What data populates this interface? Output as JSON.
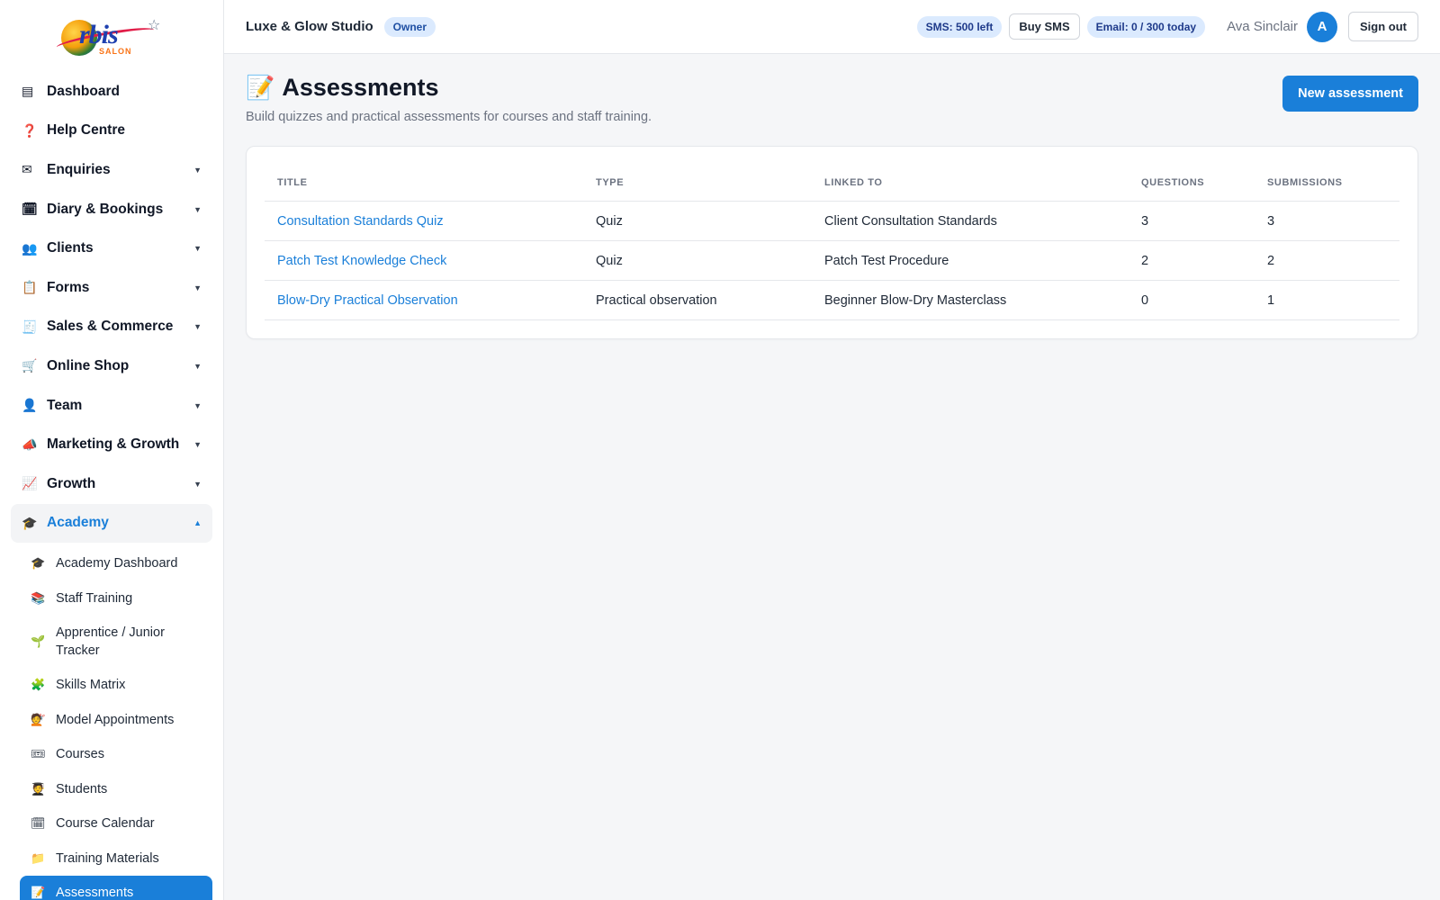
{
  "brand": {
    "logo_text": "rbis",
    "logo_sub": "SALON"
  },
  "sidebar": {
    "items": [
      {
        "label": "Dashboard",
        "icon": "▤",
        "has_caret": false
      },
      {
        "label": "Help Centre",
        "icon": "❓",
        "has_caret": false
      },
      {
        "label": "Enquiries",
        "icon": "✉",
        "has_caret": true
      },
      {
        "label": "Diary & Bookings",
        "icon": "🗓",
        "has_caret": true
      },
      {
        "label": "Clients",
        "icon": "👥",
        "has_caret": true
      },
      {
        "label": "Forms",
        "icon": "📋",
        "has_caret": true
      },
      {
        "label": "Sales & Commerce",
        "icon": "🧾",
        "has_caret": true
      },
      {
        "label": "Online Shop",
        "icon": "🛒",
        "has_caret": true
      },
      {
        "label": "Team",
        "icon": "👤",
        "has_caret": true
      },
      {
        "label": "Marketing & Growth",
        "icon": "📣",
        "has_caret": true
      },
      {
        "label": "Growth",
        "icon": "📈",
        "has_caret": true
      }
    ],
    "open_section": {
      "label": "Academy",
      "icon": "🎓"
    },
    "caret_down": "▼",
    "caret_up": "▲",
    "sub_items": [
      {
        "label": "Academy Dashboard",
        "icon": "🎓"
      },
      {
        "label": "Staff Training",
        "icon": "📚"
      },
      {
        "label": "Apprentice / Junior Tracker",
        "icon": "🌱"
      },
      {
        "label": "Skills Matrix",
        "icon": "🧩"
      },
      {
        "label": "Model Appointments",
        "icon": "💇"
      },
      {
        "label": "Courses",
        "icon": "🎟"
      },
      {
        "label": "Students",
        "icon": "🧑‍🎓"
      },
      {
        "label": "Course Calendar",
        "icon": "🗓"
      },
      {
        "label": "Training Materials",
        "icon": "📁"
      },
      {
        "label": "Assessments",
        "icon": "📝",
        "active": true
      }
    ]
  },
  "topbar": {
    "studio_name": "Luxe & Glow Studio",
    "role": "Owner",
    "sms_pill": "SMS: 500 left",
    "buy_sms": "Buy SMS",
    "email_pill": "Email: 0 / 300 today",
    "user_name": "Ava Sinclair",
    "avatar_initial": "A",
    "sign_out": "Sign out"
  },
  "page": {
    "icon": "📝",
    "title": "Assessments",
    "subtitle": "Build quizzes and practical assessments for courses and staff training.",
    "new_button": "New assessment"
  },
  "table": {
    "columns": [
      "TITLE",
      "TYPE",
      "LINKED TO",
      "QUESTIONS",
      "SUBMISSIONS"
    ],
    "rows": [
      {
        "title": "Consultation Standards Quiz",
        "type": "Quiz",
        "linked_to": "Client Consultation Standards",
        "questions": "3",
        "submissions": "3"
      },
      {
        "title": "Patch Test Knowledge Check",
        "type": "Quiz",
        "linked_to": "Patch Test Procedure",
        "questions": "2",
        "submissions": "2"
      },
      {
        "title": "Blow-Dry Practical Observation",
        "type": "Practical observation",
        "linked_to": "Beginner Blow-Dry Masterclass",
        "questions": "0",
        "submissions": "1"
      }
    ]
  },
  "colors": {
    "accent": "#1a7fd9",
    "badge_bg": "#dbeafe",
    "page_bg": "#f5f6f8"
  }
}
